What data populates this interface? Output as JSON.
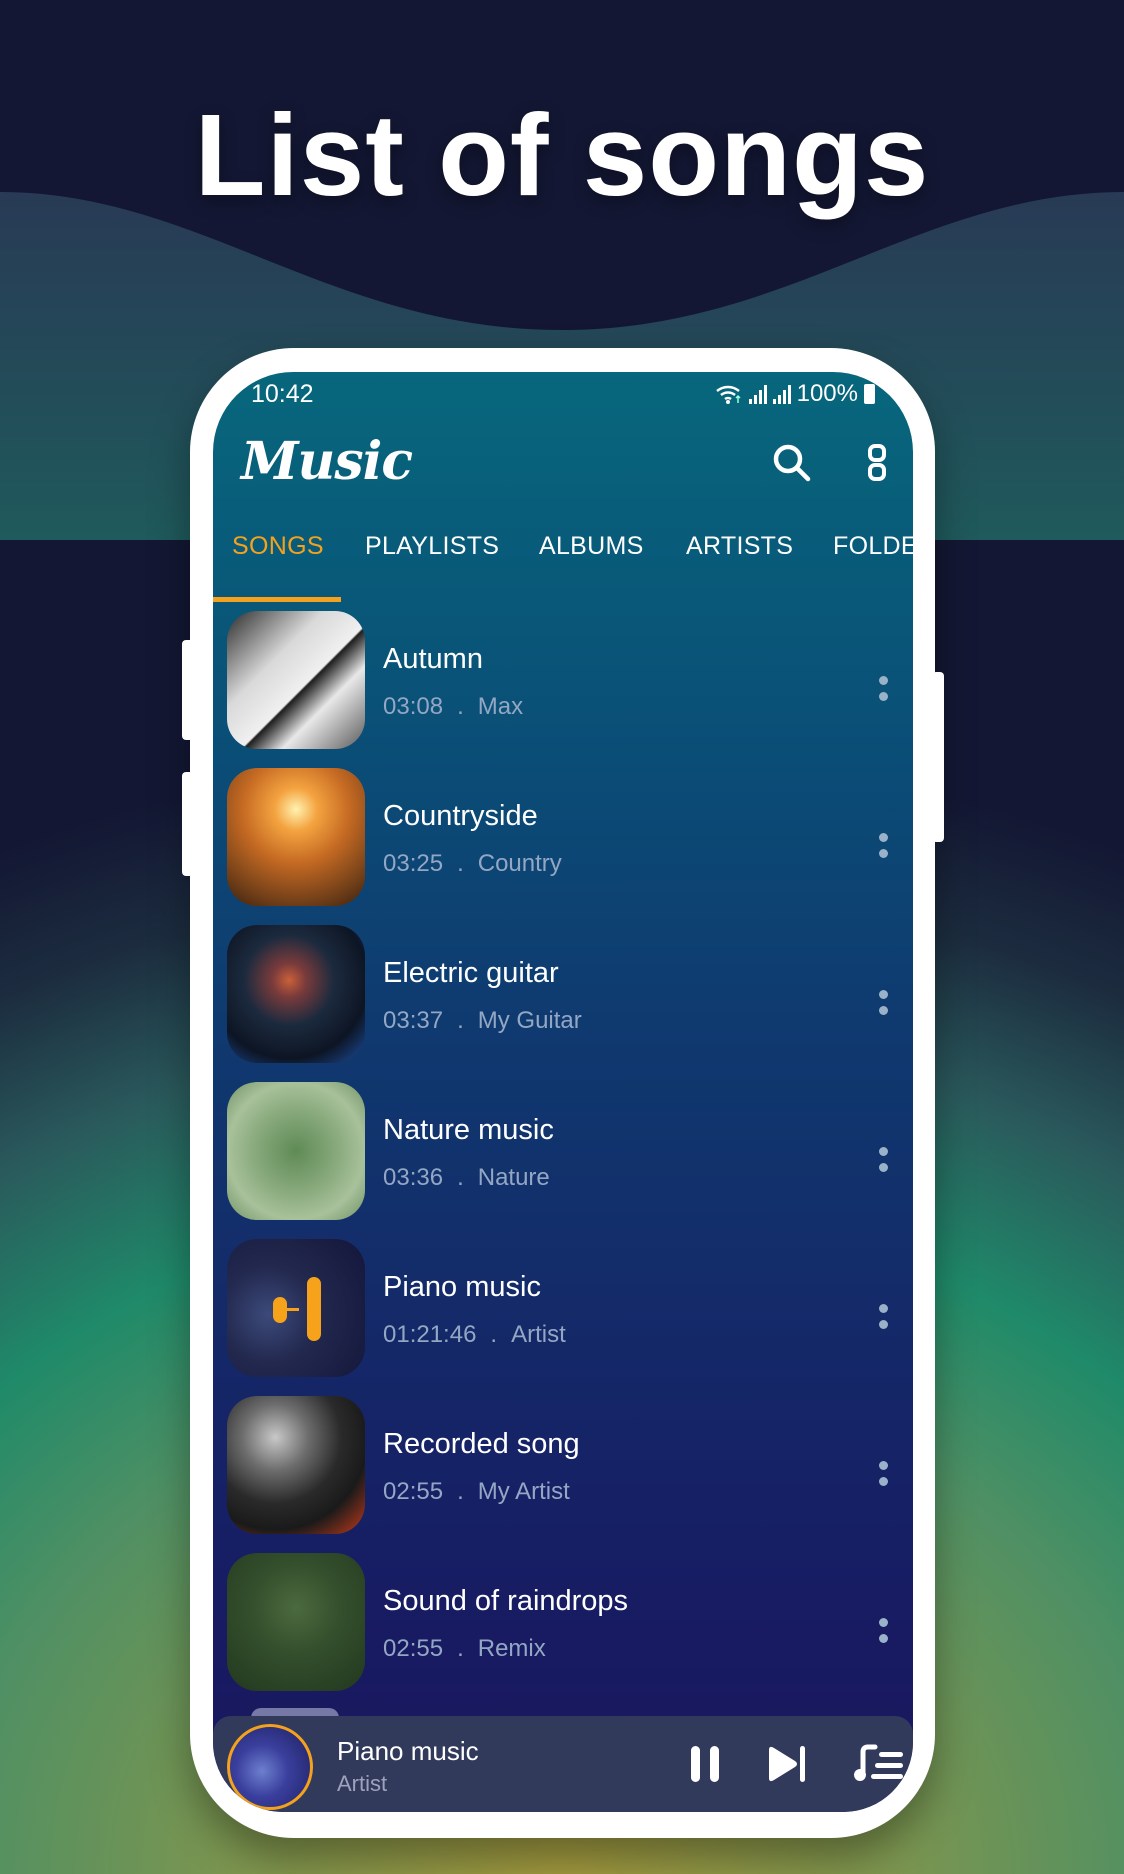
{
  "promo": {
    "title": "List of songs"
  },
  "status_bar": {
    "time": "10:42",
    "battery": "100%"
  },
  "app": {
    "logo": "Music",
    "search_icon": "search-icon",
    "menu_icon": "more-vert-icon"
  },
  "tabs": [
    {
      "label": "SONGS",
      "active": true
    },
    {
      "label": "PLAYLISTS",
      "active": false
    },
    {
      "label": "ALBUMS",
      "active": false
    },
    {
      "label": "ARTISTS",
      "active": false
    },
    {
      "label": "FOLDE",
      "active": false
    }
  ],
  "songs": [
    {
      "title": "Autumn",
      "duration": "03:08",
      "separator": ".",
      "artist": "Max",
      "art": "piano-keys"
    },
    {
      "title": "Countryside",
      "duration": "03:25",
      "separator": ".",
      "artist": "Country",
      "art": "wheat-sunset"
    },
    {
      "title": "Electric guitar",
      "duration": "03:37",
      "separator": ".",
      "artist": "My Guitar",
      "art": "guitar-concert"
    },
    {
      "title": "Nature music",
      "duration": "03:36",
      "separator": ".",
      "artist": "Nature",
      "art": "green-leaves"
    },
    {
      "title": "Piano music",
      "duration": "01:21:46",
      "separator": ".",
      "artist": "Artist",
      "art": "mic-waveform"
    },
    {
      "title": "Recorded song",
      "duration": "02:55",
      "separator": ".",
      "artist": "My Artist",
      "art": "dj-controller"
    },
    {
      "title": "Sound of raindrops",
      "duration": "02:55",
      "separator": ".",
      "artist": "Remix",
      "art": "dark-leaves"
    }
  ],
  "now_playing": {
    "title": "Piano music",
    "artist": "Artist",
    "state": "playing"
  },
  "colors": {
    "accent": "#f4a21d",
    "mini_player_bg": "#323a5c",
    "subtext": "#93a7c5"
  }
}
